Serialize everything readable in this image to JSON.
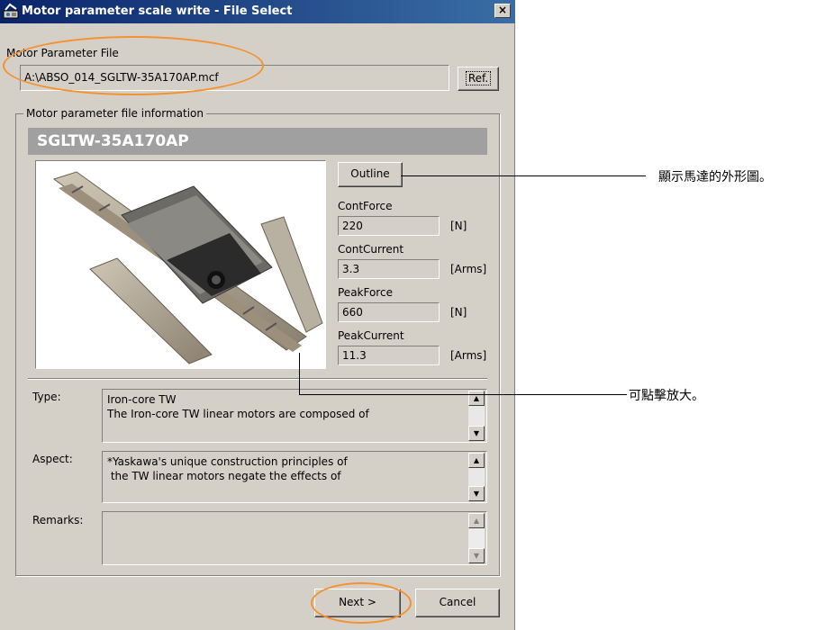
{
  "window": {
    "title": "Motor parameter scale write - File Select",
    "close_label": "×"
  },
  "file": {
    "label": "Motor Parameter File",
    "path": "A:\\ABSO_014_SGLTW-35A170AP.mcf",
    "ref_label": "Ref."
  },
  "info": {
    "group_title": "Motor parameter file information",
    "model": "SGLTW-35A170AP",
    "outline_label": "Outline",
    "specs": [
      {
        "label": "ContForce",
        "value": "220",
        "unit": "[N]"
      },
      {
        "label": "ContCurrent",
        "value": "3.3",
        "unit": "[Arms]"
      },
      {
        "label": "PeakForce",
        "value": "660",
        "unit": "[N]"
      },
      {
        "label": "PeakCurrent",
        "value": "11.3",
        "unit": "[Arms]"
      }
    ],
    "type_label": "Type:",
    "type_text": [
      "Iron-core TW",
      "The Iron-core TW linear motors are composed of"
    ],
    "aspect_label": "Aspect:",
    "aspect_text": [
      "*Yaskawa's unique construction principles of",
      " the TW linear motors negate the effects of"
    ],
    "remarks_label": "Remarks:"
  },
  "footer": {
    "next_label": "Next >",
    "cancel_label": "Cancel"
  },
  "annotations": {
    "outline_note": "顯示馬達的外形圖。",
    "zoom_note": "可點擊放大。"
  },
  "colors": {
    "highlight": "#f5922f",
    "titlebar": "#0a246a",
    "dialog_bg": "#d4d0c8",
    "banner_bg": "#a0a0a0"
  },
  "icons": {
    "title": "app-window-icon",
    "scroll_up": "arrow-up-icon",
    "scroll_down": "arrow-down-icon"
  }
}
